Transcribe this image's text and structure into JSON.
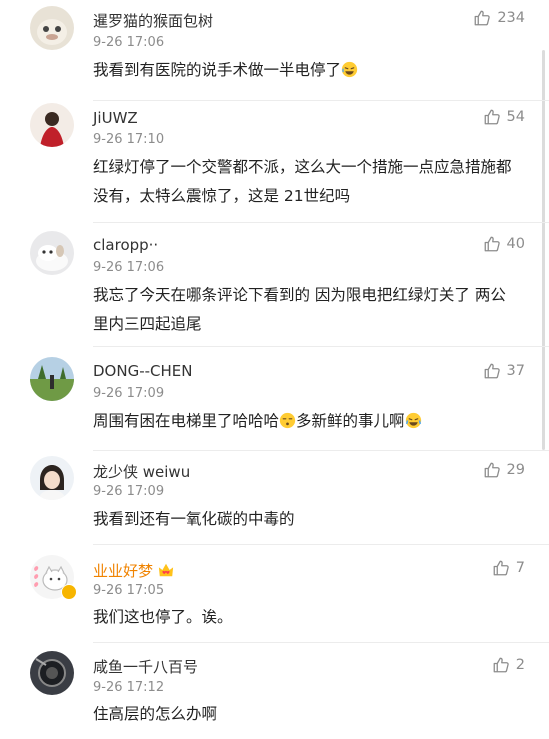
{
  "comments": [
    {
      "name": "暹罗猫的猴面包树",
      "time": "9-26 17:06",
      "likes": "234",
      "text": "我看到有医院的说手术做一半电停了"
    },
    {
      "name": "JiUWZ",
      "time": "9-26 17:10",
      "likes": "54",
      "text": "红绿灯停了一个交警都不派，这么大一个措施一点应急措施都没有，太特么震惊了，这是 21世纪吗"
    },
    {
      "name": "claropp··",
      "time": "9-26 17:06",
      "likes": "40",
      "text": "我忘了今天在哪条评论下看到的 因为限电把红绿灯关了 两公里内三四起追尾"
    },
    {
      "name": "DONG--CHEN",
      "time": "9-26 17:09",
      "likes": "37",
      "text_a": "周围有困在电梯里了哈哈哈",
      "text_b": "多新鲜的事儿啊"
    },
    {
      "name": "龙少侠 weiwu",
      "time": "9-26 17:09",
      "likes": "29",
      "text": "我看到还有一氧化碳的中毒的"
    },
    {
      "name": "业业好梦",
      "time": "9-26 17:05",
      "likes": "7",
      "text": "我们这也停了。诶。"
    },
    {
      "name": "咸鱼一千八百号",
      "time": "9-26 17:12",
      "likes": "2",
      "text": "住高层的怎么办啊"
    }
  ],
  "colors": {
    "vip_name": "#f08300",
    "meta": "#8c8c8c"
  },
  "icons": [
    "thumbs-up-icon",
    "laughing-emoji-icon",
    "dizzy-emoji-icon",
    "crying-laughing-emoji-icon",
    "heart-eyes-emoji-icon"
  ]
}
